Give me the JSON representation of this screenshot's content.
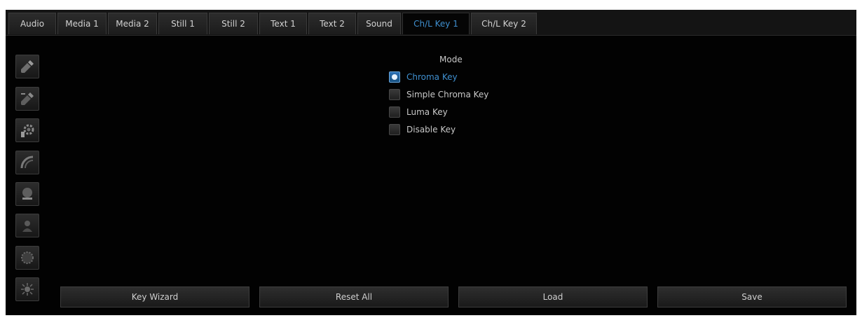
{
  "tabs": [
    {
      "label": "Audio"
    },
    {
      "label": "Media 1"
    },
    {
      "label": "Media 2"
    },
    {
      "label": "Still 1"
    },
    {
      "label": "Still 2"
    },
    {
      "label": "Text 1"
    },
    {
      "label": "Text 2"
    },
    {
      "label": "Sound"
    },
    {
      "label": "Ch/L Key 1"
    },
    {
      "label": "Ch/L Key 2"
    }
  ],
  "active_tab": "Ch/L Key 1",
  "sidebar": {
    "icons": [
      "eyedropper-icon",
      "eyedropper-remove-icon",
      "gear-settings-icon",
      "spill-suppress-icon",
      "matte-icon",
      "mask-icon",
      "edge-icon",
      "light-icon"
    ]
  },
  "mode": {
    "title": "Mode",
    "options": [
      {
        "label": "Chroma Key",
        "checked": true
      },
      {
        "label": "Simple Chroma Key",
        "checked": false
      },
      {
        "label": "Luma Key",
        "checked": false
      },
      {
        "label": "Disable Key",
        "checked": false
      }
    ]
  },
  "buttons": {
    "key_wizard": "Key Wizard",
    "reset_all": "Reset All",
    "load": "Load",
    "save": "Save"
  },
  "colors": {
    "accent": "#3f8fcf",
    "background": "#020202",
    "text": "#c8c8c8"
  }
}
